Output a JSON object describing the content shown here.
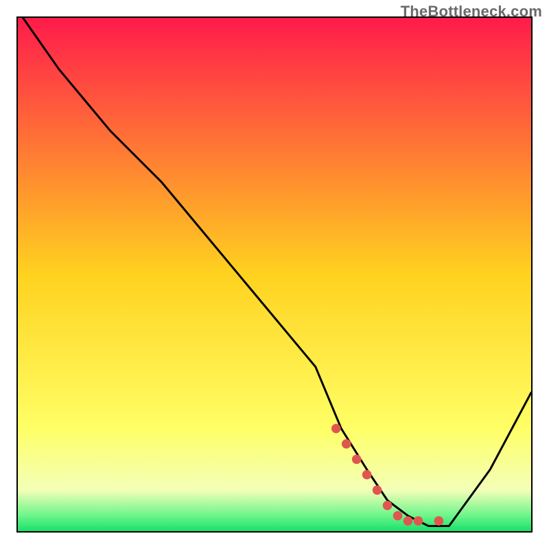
{
  "watermark": "TheBottleneck.com",
  "chart_data": {
    "type": "line",
    "title": "",
    "xlabel": "",
    "ylabel": "",
    "xlim": [
      0,
      100
    ],
    "ylim": [
      0,
      100
    ],
    "background_gradient": {
      "stops": [
        {
          "offset": 0.0,
          "color": "#ff1b4b"
        },
        {
          "offset": 0.5,
          "color": "#ffd21f"
        },
        {
          "offset": 0.8,
          "color": "#ffff66"
        },
        {
          "offset": 0.92,
          "color": "#f3ffb8"
        },
        {
          "offset": 0.97,
          "color": "#6cf58a"
        },
        {
          "offset": 1.0,
          "color": "#18e06a"
        }
      ]
    },
    "series": [
      {
        "name": "bottleneck-curve",
        "type": "line",
        "color": "#000000",
        "width": 2,
        "x": [
          1,
          8,
          18,
          28,
          38,
          48,
          58,
          63,
          68,
          72,
          76,
          80,
          84,
          92,
          100
        ],
        "y": [
          100,
          90,
          78,
          68,
          56,
          44,
          32,
          20,
          12,
          6,
          3,
          1,
          1,
          12,
          27
        ]
      },
      {
        "name": "optimal-marker",
        "type": "scatter",
        "color": "#e0564e",
        "size": 14,
        "x": [
          62,
          64,
          66,
          68,
          70,
          72,
          74,
          76,
          78,
          82
        ],
        "y": [
          20,
          17,
          14,
          11,
          8,
          5,
          3,
          2,
          2,
          2
        ]
      }
    ]
  }
}
